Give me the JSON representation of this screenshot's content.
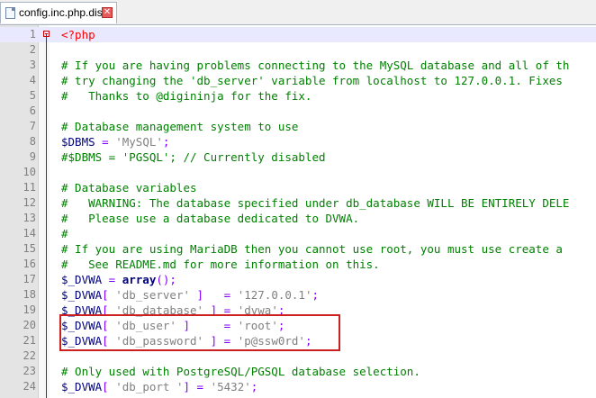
{
  "tab": {
    "title": "config.inc.php.dist",
    "close_glyph": "✕"
  },
  "editor": {
    "lines": [
      {
        "num": "1",
        "code": "<?php",
        "cls": "php"
      },
      {
        "num": "2",
        "code": "",
        "cls": ""
      },
      {
        "num": "3",
        "code": "# If you are having problems connecting to the MySQL database and all of th",
        "cls": "cm"
      },
      {
        "num": "4",
        "code": "# try changing the 'db_server' variable from localhost to 127.0.0.1. Fixes",
        "cls": "cm"
      },
      {
        "num": "5",
        "code": "#   Thanks to @digininja for the fix.",
        "cls": "cm"
      },
      {
        "num": "6",
        "code": "",
        "cls": ""
      },
      {
        "num": "7",
        "code": "# Database management system to use",
        "cls": "cm"
      },
      {
        "num": "8",
        "code": "",
        "cls": "",
        "parts": [
          [
            "$DBMS",
            "var"
          ],
          [
            " = ",
            "op"
          ],
          [
            "'MySQL'",
            "str"
          ],
          [
            ";",
            "op"
          ]
        ]
      },
      {
        "num": "9",
        "code": "#$DBMS = 'PGSQL'; // Currently disabled",
        "cls": "cm"
      },
      {
        "num": "10",
        "code": "",
        "cls": ""
      },
      {
        "num": "11",
        "code": "# Database variables",
        "cls": "cm"
      },
      {
        "num": "12",
        "code": "#   WARNING: The database specified under db_database WILL BE ENTIRELY DELE",
        "cls": "cm"
      },
      {
        "num": "13",
        "code": "#   Please use a database dedicated to DVWA.",
        "cls": "cm"
      },
      {
        "num": "14",
        "code": "#",
        "cls": "cm"
      },
      {
        "num": "15",
        "code": "# If you are using MariaDB then you cannot use root, you must use create a",
        "cls": "cm"
      },
      {
        "num": "16",
        "code": "#   See README.md for more information on this.",
        "cls": "cm"
      },
      {
        "num": "17",
        "code": "",
        "cls": "",
        "parts": [
          [
            "$_DVWA",
            "var"
          ],
          [
            " = ",
            "op"
          ],
          [
            "array",
            "kw"
          ],
          [
            "();",
            "op"
          ]
        ]
      },
      {
        "num": "18",
        "code": "",
        "cls": "",
        "parts": [
          [
            "$_DVWA",
            "var"
          ],
          [
            "[ ",
            "op"
          ],
          [
            "'db_server'",
            "str"
          ],
          [
            " ]   = ",
            "op"
          ],
          [
            "'127.0.0.1'",
            "str"
          ],
          [
            ";",
            "op"
          ]
        ]
      },
      {
        "num": "19",
        "code": "",
        "cls": "",
        "parts": [
          [
            "$_DVWA",
            "var"
          ],
          [
            "[ ",
            "op"
          ],
          [
            "'db_database'",
            "str"
          ],
          [
            " ] = ",
            "op"
          ],
          [
            "'dvwa'",
            "str"
          ],
          [
            ";",
            "op"
          ]
        ]
      },
      {
        "num": "20",
        "code": "",
        "cls": "",
        "parts": [
          [
            "$_DVWA",
            "var"
          ],
          [
            "[ ",
            "op"
          ],
          [
            "'db_user'",
            "str"
          ],
          [
            " ]     = ",
            "op"
          ],
          [
            "'root'",
            "str"
          ],
          [
            ";",
            "op"
          ]
        ]
      },
      {
        "num": "21",
        "code": "",
        "cls": "",
        "parts": [
          [
            "$_DVWA",
            "var"
          ],
          [
            "[ ",
            "op"
          ],
          [
            "'db_password'",
            "str"
          ],
          [
            " ] = ",
            "op"
          ],
          [
            "'p@ssw0rd'",
            "str"
          ],
          [
            ";",
            "op"
          ]
        ]
      },
      {
        "num": "22",
        "code": "",
        "cls": ""
      },
      {
        "num": "23",
        "code": "# Only used with PostgreSQL/PGSQL database selection.",
        "cls": "cm"
      },
      {
        "num": "24",
        "code": "",
        "cls": "",
        "parts": [
          [
            "$_DVWA",
            "var"
          ],
          [
            "[ ",
            "op"
          ],
          [
            "'db_port '",
            "str"
          ],
          [
            "] = ",
            "op"
          ],
          [
            "'5432'",
            "str"
          ],
          [
            ";",
            "op"
          ]
        ]
      }
    ],
    "current_line": "1"
  },
  "colors": {
    "comment": "#008000",
    "string": "#808080",
    "variable": "#000080",
    "operator": "#8000ff",
    "php_tag": "#ff0000",
    "highlight_box": "#cc1f1f"
  }
}
